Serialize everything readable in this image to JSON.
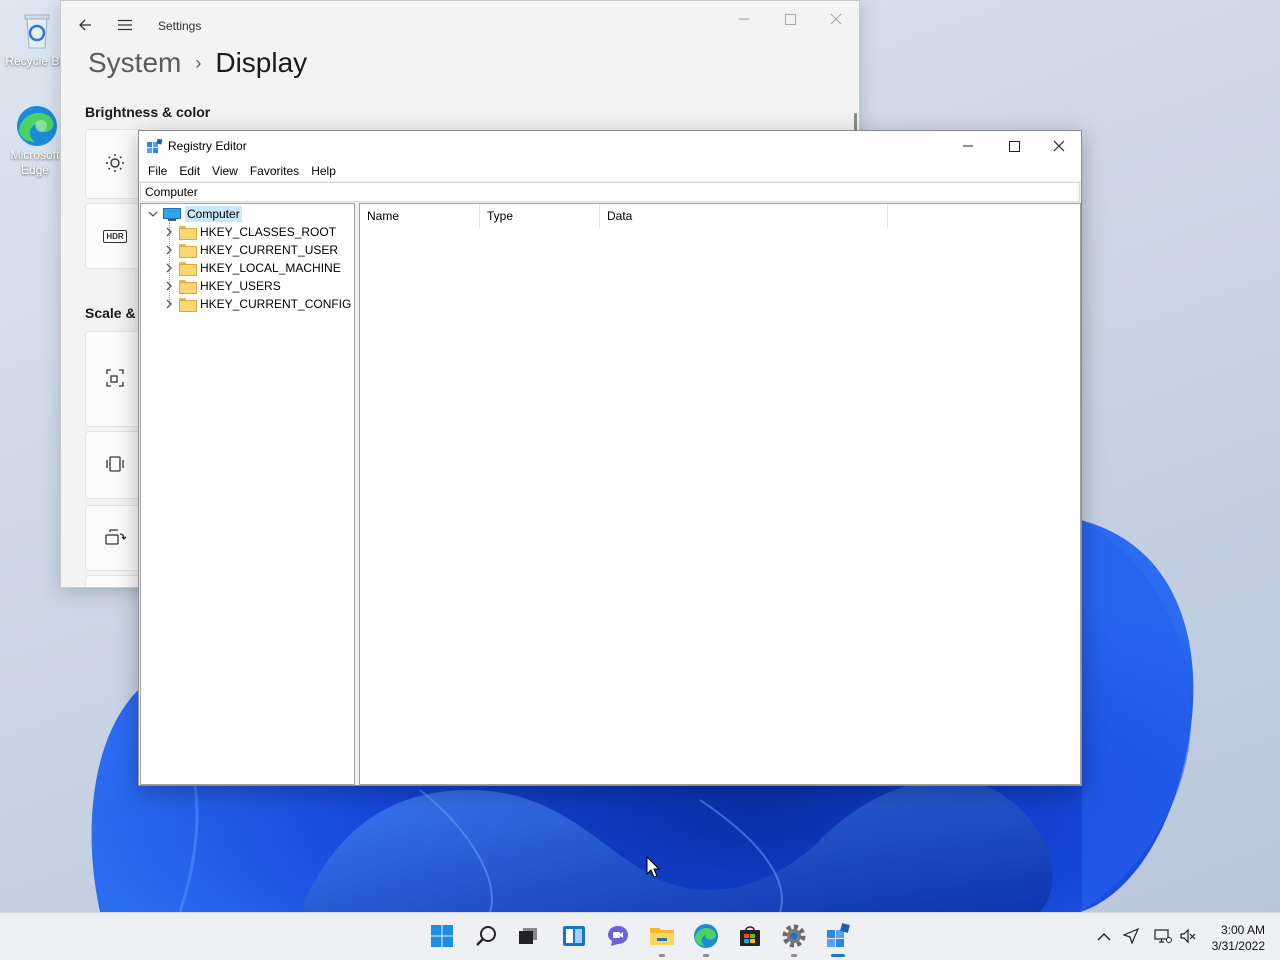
{
  "desktop": {
    "icons": [
      {
        "label": "Recycle Bin",
        "icon": "recycle-bin-icon"
      },
      {
        "label": "Microsoft Edge",
        "icon": "edge-icon"
      }
    ]
  },
  "settings": {
    "app_title": "Settings",
    "breadcrumb_parent": "System",
    "breadcrumb_current": "Display",
    "section_brightness": "Brightness & color",
    "section_scale": "Scale & l",
    "cards": [
      "brightness-icon",
      "hdr-icon",
      "scale-icon",
      "resolution-icon",
      "orientation-icon"
    ],
    "hdr_text": "HDR"
  },
  "regedit": {
    "title": "Registry Editor",
    "menu": [
      "File",
      "Edit",
      "View",
      "Favorites",
      "Help"
    ],
    "address": "Computer",
    "tree_root": "Computer",
    "hives": [
      "HKEY_CLASSES_ROOT",
      "HKEY_CURRENT_USER",
      "HKEY_LOCAL_MACHINE",
      "HKEY_USERS",
      "HKEY_CURRENT_CONFIG"
    ],
    "columns": [
      "Name",
      "Type",
      "Data"
    ]
  },
  "taskbar": {
    "apps": [
      "start-icon",
      "search-icon",
      "task-view-icon",
      "widgets-icon",
      "chat-icon",
      "file-explorer-icon",
      "edge-icon",
      "store-icon",
      "settings-icon",
      "regedit-icon"
    ],
    "clock_time": "3:00 AM",
    "clock_date": "3/31/2022"
  },
  "colors": {
    "accent": "#1a73c9",
    "selection": "#cce8ff",
    "wallpaper_blue": "#1a4fd6"
  }
}
